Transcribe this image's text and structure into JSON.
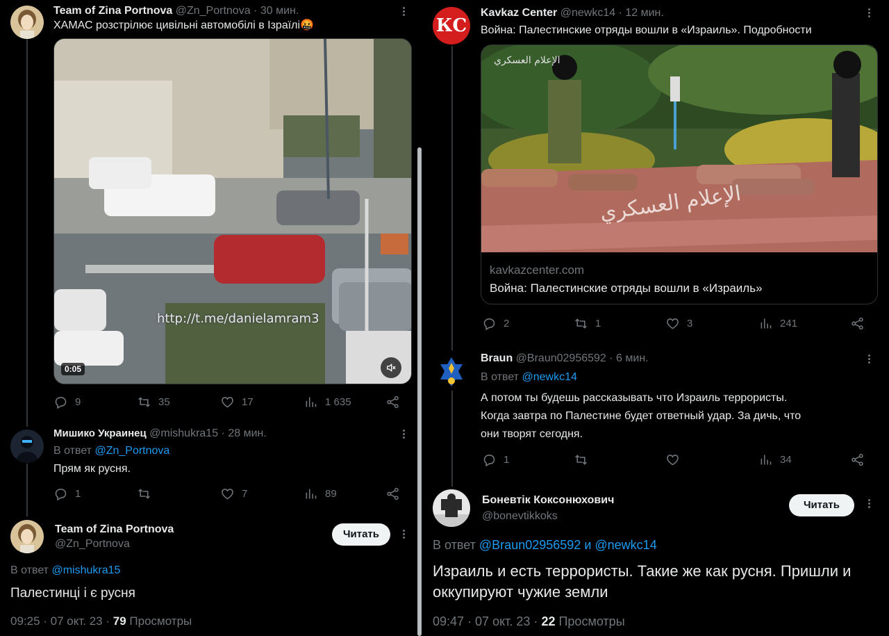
{
  "left": {
    "tweet1": {
      "name": "Team of Zina Portnova",
      "handle": "@Zn_Portnova",
      "sep": "·",
      "time": "30 мин.",
      "text": "ХАМАС розстрілює цивільні автомобілі в Ізраїлі🤬",
      "video_time": "0:05",
      "watermark": "http://t.me/danielamram3",
      "replies": "9",
      "retweets": "35",
      "likes": "17",
      "views": "1 635"
    },
    "reply1": {
      "name": "Мишико Украинец",
      "handle": "@mishukra15",
      "sep": "·",
      "time": "28 мин.",
      "reply_prefix": "В ответ",
      "reply_to": "@Zn_Portnova",
      "text": "Прям як русня.",
      "replies": "1",
      "retweets": "",
      "likes": "7",
      "views": "89"
    },
    "main": {
      "name": "Team of Zina Portnova",
      "handle": "@Zn_Portnova",
      "follow": "Читать",
      "reply_prefix": "В ответ",
      "reply_to": "@mishukra15",
      "text": "Палестинці і є русня",
      "timestamp": "09:25 · 07 окт. 23 ·",
      "views_count": "79",
      "views_label": "Просмотры"
    }
  },
  "right": {
    "tweet1": {
      "name": "Kavkaz Center",
      "handle": "@newkc14",
      "sep": "·",
      "time": "12 мин.",
      "text": "Война: Палестинские отряды вошли в «Израиль». Подробности",
      "avatar_text": "КС",
      "image_watermark": "الإعلام العسكري",
      "card_domain": "kavkazcenter.com",
      "card_title": "Война: Палестинские отряды вошли в «Израиль»",
      "replies": "2",
      "retweets": "1",
      "likes": "3",
      "views": "241"
    },
    "reply1": {
      "name": "Braun",
      "handle": "@Braun02956592",
      "sep": "·",
      "time": "6 мин.",
      "reply_prefix": "В ответ",
      "reply_to": "@newkc14",
      "line1": "А потом ты будешь рассказывать что Израиль террористы.",
      "line2": "Когда завтра по Палестине будет ответный удар. За дичь, что",
      "line3": "они творят сегодня.",
      "replies": "1",
      "retweets": "",
      "likes": "",
      "views": "34"
    },
    "main": {
      "name": "Боневтік Коксонюхович",
      "handle": "@bonevtikkoks",
      "follow": "Читать",
      "reply_prefix": "В ответ",
      "reply_to_1": "@Braun02956592",
      "reply_and": "и",
      "reply_to_2": "@newkc14",
      "line1": "Израиль и есть террористы. Такие же как русня. Пришли и",
      "line2": "оккупируют чужие земли",
      "timestamp": "09:47 · 07 окт. 23 ·",
      "views_count": "22",
      "views_label": "Просмотры"
    }
  },
  "colors": {
    "bg": "#000000",
    "text": "#e7e9ea",
    "muted": "#71767b",
    "link": "#1d9bf0",
    "border": "#2f3336"
  }
}
